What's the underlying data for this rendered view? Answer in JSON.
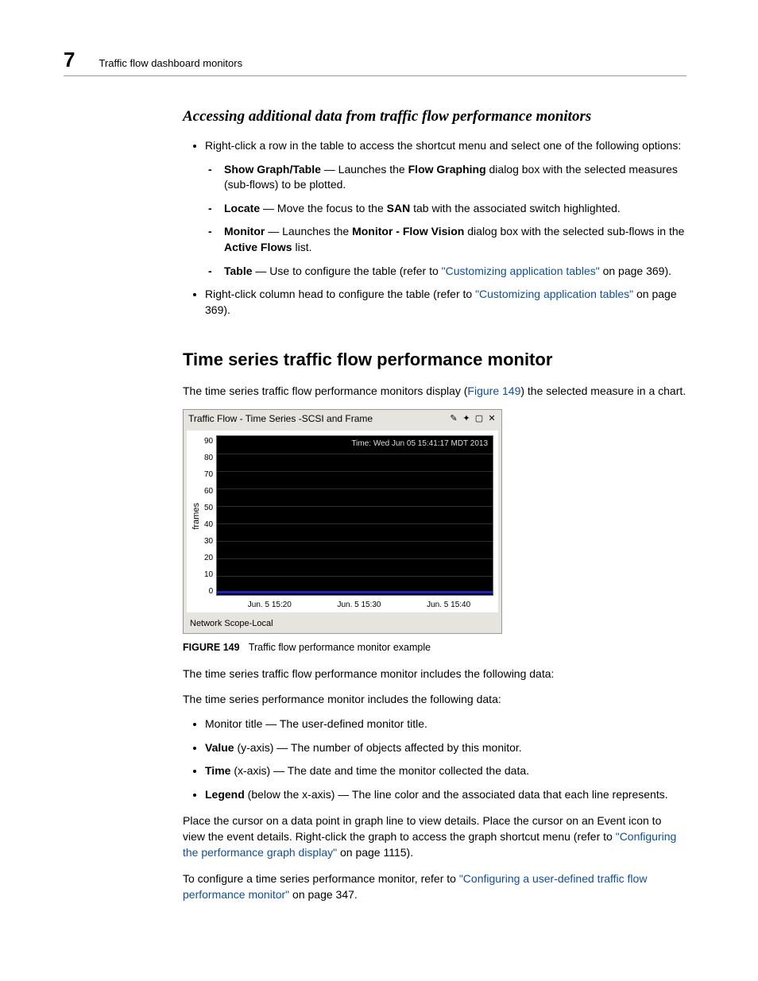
{
  "header": {
    "chapter_number": "7",
    "chapter_title": "Traffic flow dashboard monitors"
  },
  "section1": {
    "title": "Accessing additional data from traffic flow performance monitors",
    "bullet1": "Right-click a row in the table to access the shortcut menu and select one of the following options:",
    "sub1_bold": "Show Graph/Table",
    "sub1_a": " — Launches the ",
    "sub1_bold2": "Flow Graphing",
    "sub1_b": " dialog box with the selected measures (sub-flows) to be plotted.",
    "sub2_bold": "Locate",
    "sub2_a": " — Move the focus to the ",
    "sub2_bold2": "SAN",
    "sub2_b": " tab with the associated switch highlighted.",
    "sub3_bold": "Monitor",
    "sub3_a": " — Launches the ",
    "sub3_bold2": "Monitor - Flow Vision",
    "sub3_b": " dialog box with the selected sub-flows in the ",
    "sub3_bold3": "Active Flows",
    "sub3_c": " list.",
    "sub4_bold": "Table",
    "sub4_a": " — Use to configure the table (refer to ",
    "sub4_link": "\"Customizing application tables\"",
    "sub4_b": " on page 369).",
    "bullet2_a": "Right-click column head to configure the table (refer to ",
    "bullet2_link": "\"Customizing application tables\"",
    "bullet2_b": " on page 369)."
  },
  "section2": {
    "title": "Time series traffic flow performance monitor",
    "intro_a": "The time series traffic flow performance monitors display (",
    "intro_link": "Figure 149",
    "intro_b": ") the selected measure in a chart.",
    "figure_caption_label": "FIGURE 149",
    "figure_caption_text": "Traffic flow performance monitor example",
    "p1": "The time series traffic flow performance monitor includes the following data:",
    "p2": "The time series performance monitor includes the following data:",
    "b1": "Monitor title — The user-defined monitor title.",
    "b2_bold": "Value",
    "b2": " (y-axis) — The number of objects affected by this monitor.",
    "b3_bold": "Time",
    "b3": " (x-axis) — The date and time the monitor collected the data.",
    "b4_bold": "Legend",
    "b4": " (below the x-axis) — The line color and the associated data that each line represents.",
    "p3_a": "Place the cursor on a data point in graph line to view details. Place the cursor on an Event icon to view the event details. Right-click the graph to access the graph shortcut menu (refer to ",
    "p3_link": "\"Configuring the performance graph display\"",
    "p3_b": " on page 1115).",
    "p4_a": "To configure a time series performance monitor, refer to ",
    "p4_link": "\"Configuring a user-defined traffic flow performance monitor\"",
    "p4_b": " on page 347."
  },
  "chart_data": {
    "type": "line",
    "title": "Traffic Flow - Time Series -SCSI and Frame",
    "timestamp": "Time: Wed Jun 05 15:41:17 MDT 2013",
    "ylabel": "frames",
    "ylim": [
      0,
      90
    ],
    "yticks": [
      0,
      10,
      20,
      30,
      40,
      50,
      60,
      70,
      80,
      90
    ],
    "xticks": [
      "Jun. 5 15:20",
      "Jun. 5 15:30",
      "Jun. 5 15:40"
    ],
    "legend": "Network Scope-Local",
    "series": [
      {
        "name": "frames",
        "color": "#2020d0",
        "approx_constant_value": 0
      }
    ]
  }
}
